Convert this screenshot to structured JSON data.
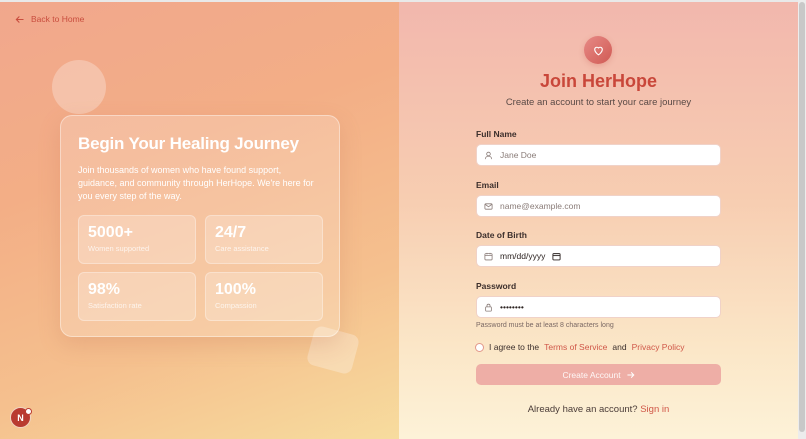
{
  "nav": {
    "back_label": "Back to Home"
  },
  "hero": {
    "title": "Begin Your Healing Journey",
    "description": "Join thousands of women who have found support, guidance, and community through HerHope. We're here for you every step of the way.",
    "stats": [
      {
        "value": "5000+",
        "label": "Women supported"
      },
      {
        "value": "24/7",
        "label": "Care assistance"
      },
      {
        "value": "98%",
        "label": "Satisfaction rate"
      },
      {
        "value": "100%",
        "label": "Compassion"
      }
    ]
  },
  "badge": {
    "letter": "N"
  },
  "form": {
    "title": "Join HerHope",
    "subtitle": "Create an account to start your care journey",
    "full_name": {
      "label": "Full Name",
      "placeholder": "Jane Doe"
    },
    "email": {
      "label": "Email",
      "placeholder": "name@example.com"
    },
    "dob": {
      "label": "Date of Birth",
      "value": "mm/dd/yyyy"
    },
    "password": {
      "label": "Password",
      "value": "••••••••",
      "hint": "Password must be at least 8 characters long"
    },
    "agree": {
      "prefix": "I agree to the",
      "terms": "Terms of Service",
      "and": "and",
      "privacy": "Privacy Policy"
    },
    "submit_label": "Create Account",
    "signin_prompt": "Already have an account?",
    "signin_link": "Sign in"
  },
  "colors": {
    "accent": "#c9473a",
    "link": "#d05748",
    "button": "#eeaea6"
  }
}
